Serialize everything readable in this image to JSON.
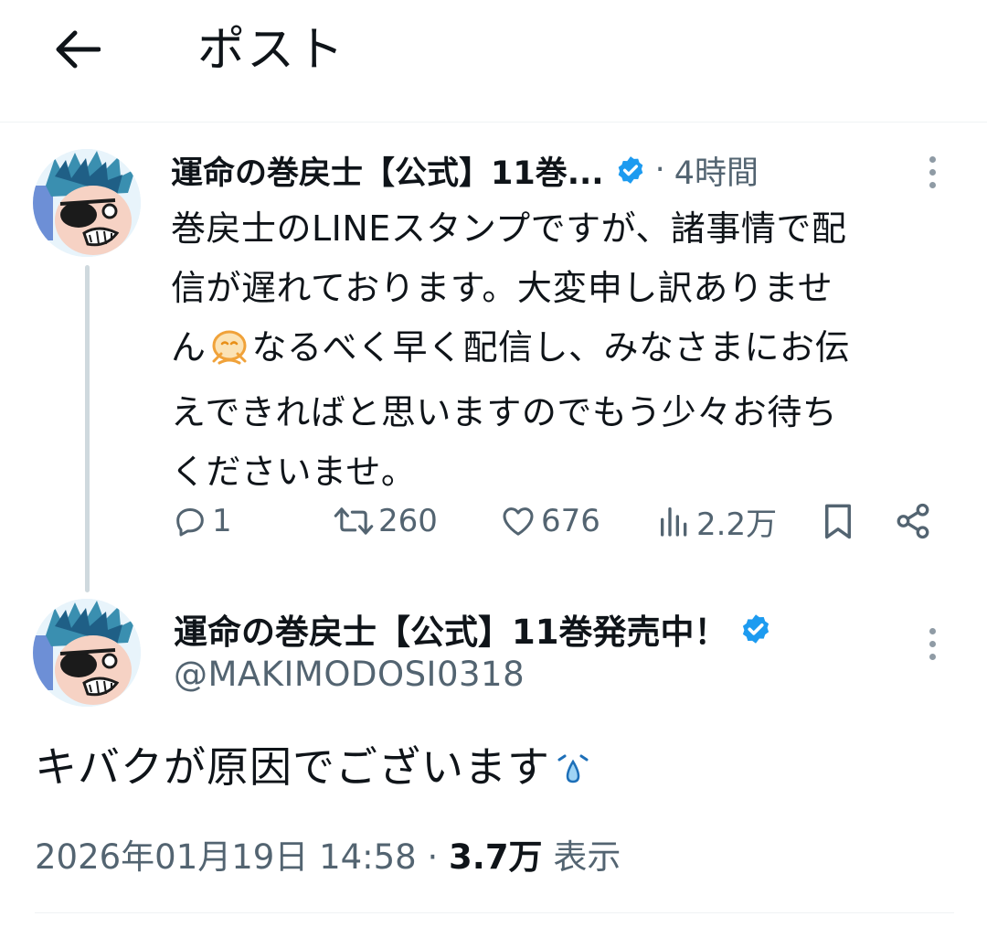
{
  "header": {
    "title": "ポスト"
  },
  "post1": {
    "display_name": "運命の巻戻士【公式】11巻...",
    "separator": "·",
    "time": "4時間",
    "body_line1": "巻戻士のLINEスタンプですが、諸事情で配",
    "body_line2": "信が遅れております。大変申し訳ありませ",
    "body_line3_pre": "ん",
    "body_line3_post": "なるべく早く配信し、みなさまにお伝",
    "body_line4": "えできればと思いますのでもう少々お待ち",
    "body_line5": "くださいませ。",
    "actions": {
      "replies": "1",
      "reposts": "260",
      "likes": "676",
      "views": "2.2万"
    }
  },
  "post2": {
    "display_name": "運命の巻戻士【公式】11巻発売中！",
    "handle": "@MAKIMODOSI0318",
    "text": "キバクが原因でございます",
    "date": "2026年01月19日 14:58",
    "separator": "·",
    "views_count": "3.7万",
    "views_label": "表示"
  },
  "colors": {
    "verified": "#1d9bf0",
    "secondary_text": "#536471",
    "thread_line": "#cfd9de"
  },
  "icons": [
    "back-arrow-icon",
    "verified-badge-icon",
    "more-icon",
    "reply-icon",
    "repost-icon",
    "like-icon",
    "views-icon",
    "bookmark-icon",
    "share-icon",
    "sad-face-emoji",
    "sweat-drop-emoji"
  ]
}
